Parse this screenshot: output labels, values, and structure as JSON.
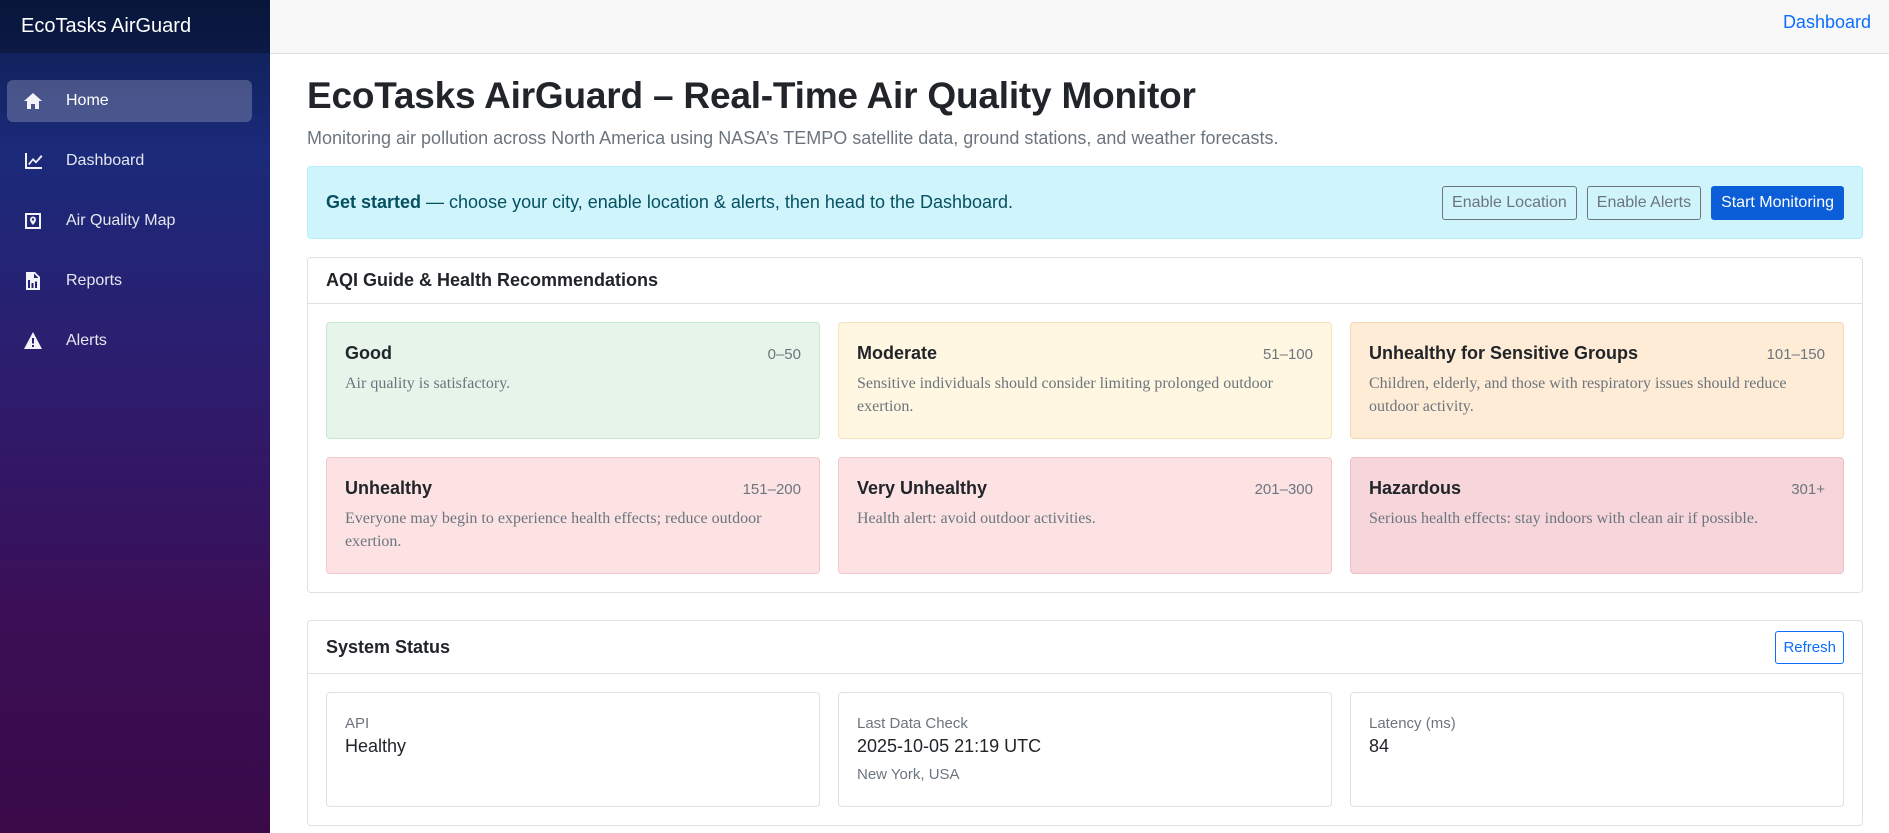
{
  "app": {
    "brand": "EcoTasks AirGuard"
  },
  "topbar": {
    "link": "Dashboard"
  },
  "sidebar": {
    "items": [
      {
        "label": "Home",
        "icon": "home-icon",
        "active": true
      },
      {
        "label": "Dashboard",
        "icon": "chart-line-icon",
        "active": false
      },
      {
        "label": "Air Quality Map",
        "icon": "map-icon",
        "active": false
      },
      {
        "label": "Reports",
        "icon": "report-icon",
        "active": false
      },
      {
        "label": "Alerts",
        "icon": "alert-icon",
        "active": false
      }
    ]
  },
  "page": {
    "title": "EcoTasks AirGuard – Real-Time Air Quality Monitor",
    "subtitle": "Monitoring air pollution across North America using NASA’s TEMPO satellite data, ground stations, and weather forecasts."
  },
  "banner": {
    "bold": "Get started",
    "text": " — choose your city, enable location & alerts, then head to the Dashboard.",
    "buttons": {
      "enable_location": "Enable Location",
      "enable_alerts": "Enable Alerts",
      "start_monitoring": "Start Monitoring"
    }
  },
  "aqi_guide": {
    "title": "AQI Guide & Health Recommendations",
    "levels": [
      {
        "name": "Good",
        "range": "0–50",
        "desc": "Air quality is satisfactory.",
        "bg": "#e6f4ea",
        "border": "#c7e6cf"
      },
      {
        "name": "Moderate",
        "range": "51–100",
        "desc": "Sensitive individuals should consider limiting prolonged outdoor exertion.",
        "bg": "#fff7e1",
        "border": "#f5e4b8"
      },
      {
        "name": "Unhealthy for Sensitive Groups",
        "range": "101–150",
        "desc": "Children, elderly, and those with respiratory issues should reduce outdoor activity.",
        "bg": "#ffecd6",
        "border": "#f7d7b3"
      },
      {
        "name": "Unhealthy",
        "range": "151–200",
        "desc": "Everyone may begin to experience health effects; reduce outdoor exertion.",
        "bg": "#fde2e4",
        "border": "#f5c6cb"
      },
      {
        "name": "Very Unhealthy",
        "range": "201–300",
        "desc": "Health alert: avoid outdoor activities.",
        "bg": "#fde2e4",
        "border": "#f5c6cb"
      },
      {
        "name": "Hazardous",
        "range": "301+",
        "desc": "Serious health effects: stay indoors with clean air if possible.",
        "bg": "#f6d6da",
        "border": "#eec1c7"
      }
    ]
  },
  "system_status": {
    "title": "System Status",
    "refresh": "Refresh",
    "api": {
      "label": "API",
      "value": "Healthy"
    },
    "last_check": {
      "label": "Last Data Check",
      "value": "2025-10-05 21:19 UTC",
      "location": "New York, USA"
    },
    "latency": {
      "label": "Latency (ms)",
      "value": "84"
    }
  }
}
